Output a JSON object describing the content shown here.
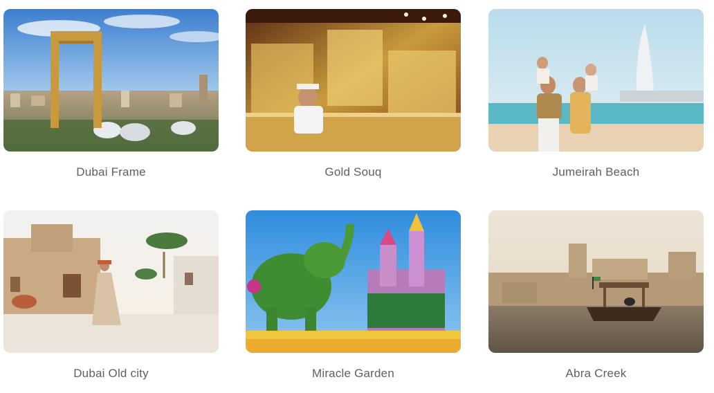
{
  "attractions": [
    {
      "title": "Dubai Frame"
    },
    {
      "title": "Gold Souq"
    },
    {
      "title": "Jumeirah Beach"
    },
    {
      "title": "Dubai Old city"
    },
    {
      "title": "Miracle Garden"
    },
    {
      "title": "Abra Creek"
    }
  ]
}
